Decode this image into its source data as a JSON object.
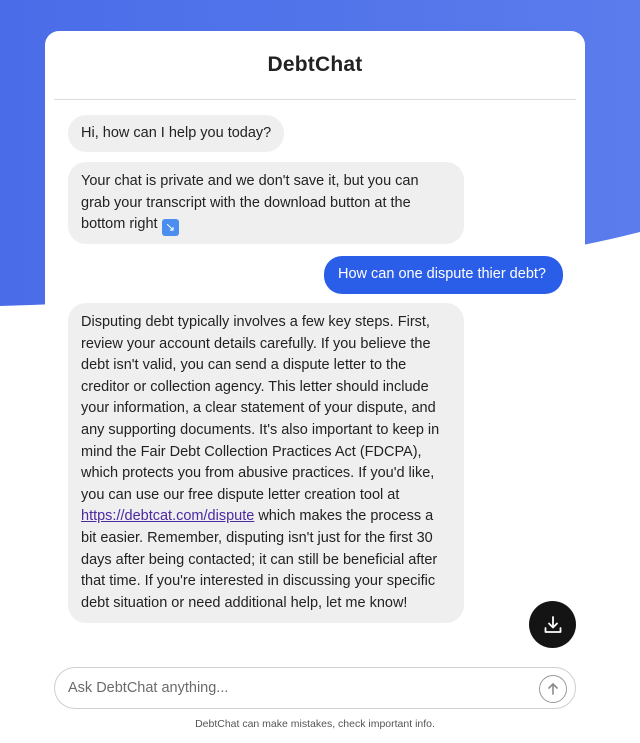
{
  "app": {
    "title": "DebtChat"
  },
  "colors": {
    "accent": "#2b5ee8",
    "background_wave": "#4f72ea",
    "bot_bubble": "#efefef",
    "download_button": "#141414"
  },
  "messages": [
    {
      "role": "bot",
      "text": "Hi, how can I help you today?"
    },
    {
      "role": "bot",
      "text": "Your chat is private and we don't save it, but you can grab your transcript with the download button at the bottom right",
      "emoji": "↘"
    },
    {
      "role": "user",
      "text": "How can one dispute thier debt?"
    },
    {
      "role": "bot",
      "text_before_link": "Disputing debt typically involves a few key steps. First, review your account details carefully. If you believe the debt isn't valid, you can send a dispute letter to the creditor or collection agency. This letter should include your information, a clear statement of your dispute, and any supporting documents. It's also important to keep in mind the Fair Debt Collection Practices Act (FDCPA), which protects you from abusive practices. If you'd like, you can use our free dispute letter creation tool at ",
      "link_text": "https://debtcat.com/dispute",
      "text_after_link": " which makes the process a bit easier. Remember, disputing isn't just for the first 30 days after being contacted; it can still be beneficial after that time. If you're interested in discussing your specific debt situation or need additional help, let me know!"
    }
  ],
  "input": {
    "placeholder": "Ask DebtChat anything...",
    "value": ""
  },
  "icons": {
    "download": "download-icon",
    "send": "arrow-up-icon"
  },
  "footer": {
    "disclaimer": "DebtChat can make mistakes, check important info."
  }
}
